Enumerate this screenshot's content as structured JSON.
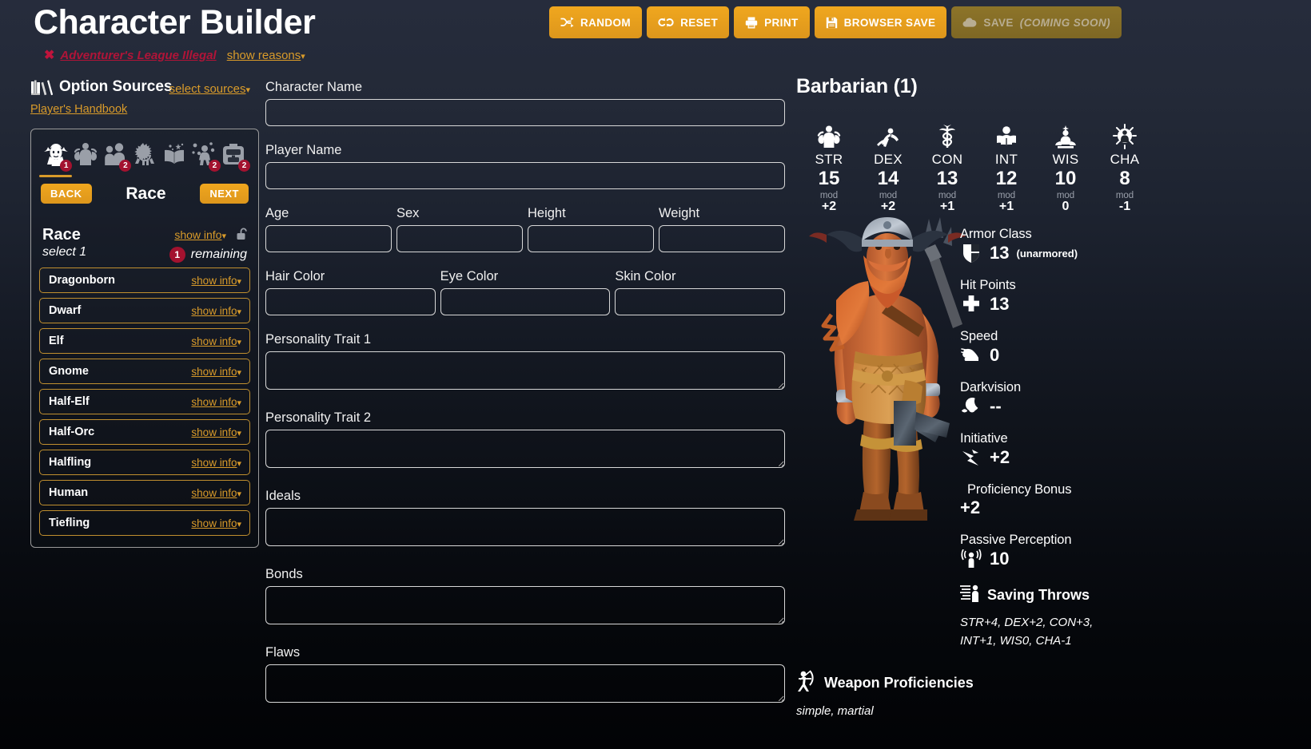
{
  "header": {
    "title": "Character Builder",
    "legality_icon": "x-mark-icon",
    "legality_text": "Adventurer's League Illegal",
    "show_reasons": "show reasons"
  },
  "toolbar": {
    "buttons": [
      {
        "label": "RANDOM",
        "icon": "shuffle-icon",
        "disabled": false
      },
      {
        "label": "RESET",
        "icon": "undo-icon",
        "disabled": false
      },
      {
        "label": "PRINT",
        "icon": "printer-icon",
        "disabled": false
      },
      {
        "label": "BROWSER SAVE",
        "icon": "floppy-disk-icon",
        "disabled": false
      },
      {
        "label": "SAVE",
        "suffix": "(COMING SOON)",
        "icon": "cloud-upload-icon",
        "disabled": true
      }
    ]
  },
  "sidebar": {
    "option_sources_title": "Option Sources",
    "option_sources_icon": "books-icon",
    "select_sources": "select sources",
    "source_name": "Player's Handbook",
    "tabs": [
      {
        "name": "race-tab",
        "icon": "elf-head-icon",
        "badge": "1",
        "active": true
      },
      {
        "name": "abilities-tab",
        "icon": "muscle-icon",
        "badge": "",
        "active": false
      },
      {
        "name": "background-tab",
        "icon": "people-icon",
        "badge": "2",
        "active": false
      },
      {
        "name": "class-tab",
        "icon": "knight-horse-icon",
        "badge": "",
        "active": false
      },
      {
        "name": "spells-tab",
        "icon": "spellbook-icon",
        "badge": "",
        "active": false
      },
      {
        "name": "feats-tab",
        "icon": "juggler-icon",
        "badge": "2",
        "active": false
      },
      {
        "name": "equipment-tab",
        "icon": "backpack-icon",
        "badge": "2",
        "active": false
      }
    ],
    "back_label": "BACK",
    "next_label": "NEXT",
    "step_title": "Race",
    "race_section": {
      "label": "Race",
      "select_hint": "select 1",
      "show_info": "show info",
      "lock_icon": "open-lock-icon",
      "remaining_count": "1",
      "remaining_text": "remaining",
      "items": [
        {
          "name": "Dragonborn",
          "show_info": "show info"
        },
        {
          "name": "Dwarf",
          "show_info": "show info"
        },
        {
          "name": "Elf",
          "show_info": "show info"
        },
        {
          "name": "Gnome",
          "show_info": "show info"
        },
        {
          "name": "Half-Elf",
          "show_info": "show info"
        },
        {
          "name": "Half-Orc",
          "show_info": "show info"
        },
        {
          "name": "Halfling",
          "show_info": "show info"
        },
        {
          "name": "Human",
          "show_info": "show info"
        },
        {
          "name": "Tiefling",
          "show_info": "show info"
        }
      ]
    }
  },
  "form": {
    "character_name": {
      "label": "Character Name",
      "value": ""
    },
    "player_name": {
      "label": "Player Name",
      "value": ""
    },
    "age": {
      "label": "Age",
      "value": ""
    },
    "sex": {
      "label": "Sex",
      "value": ""
    },
    "height": {
      "label": "Height",
      "value": ""
    },
    "weight": {
      "label": "Weight",
      "value": ""
    },
    "hair_color": {
      "label": "Hair Color",
      "value": ""
    },
    "eye_color": {
      "label": "Eye Color",
      "value": ""
    },
    "skin_color": {
      "label": "Skin Color",
      "value": ""
    },
    "trait1": {
      "label": "Personality Trait 1",
      "value": ""
    },
    "trait2": {
      "label": "Personality Trait 2",
      "value": ""
    },
    "ideals": {
      "label": "Ideals",
      "value": ""
    },
    "bonds": {
      "label": "Bonds",
      "value": ""
    },
    "flaws": {
      "label": "Flaws",
      "value": ""
    }
  },
  "character": {
    "class_level": "Barbarian (1)",
    "portrait_icon": "barbarian-portrait",
    "abilities": [
      {
        "name": "STR",
        "score": "15",
        "mod_label": "mod",
        "mod": "+2",
        "icon": "muscle-flex-icon"
      },
      {
        "name": "DEX",
        "score": "14",
        "mod_label": "mod",
        "mod": "+2",
        "icon": "acrobat-icon"
      },
      {
        "name": "CON",
        "score": "13",
        "mod_label": "mod",
        "mod": "+1",
        "icon": "caduceus-icon"
      },
      {
        "name": "INT",
        "score": "12",
        "mod_label": "mod",
        "mod": "+1",
        "icon": "reading-icon"
      },
      {
        "name": "WIS",
        "score": "10",
        "mod_label": "mod",
        "mod": "0",
        "icon": "meditation-icon"
      },
      {
        "name": "CHA",
        "score": "8",
        "mod_label": "mod",
        "mod": "-1",
        "icon": "sun-person-icon"
      }
    ],
    "stats": {
      "armor_class": {
        "label": "Armor Class",
        "value": "13",
        "note": "(unarmored)",
        "icon": "shield-icon"
      },
      "hit_points": {
        "label": "Hit Points",
        "value": "13",
        "icon": "cross-icon"
      },
      "speed": {
        "label": "Speed",
        "value": "0",
        "icon": "boot-icon"
      },
      "darkvision": {
        "label": "Darkvision",
        "value": "--",
        "icon": "night-eyes-icon"
      },
      "initiative": {
        "label": "Initiative",
        "value": "+2",
        "icon": "running-arrow-icon"
      },
      "proficiency_bonus": {
        "label": "Proficiency Bonus",
        "value": "+2"
      },
      "passive_perception": {
        "label": "Passive Perception",
        "value": "10",
        "icon": "perception-icon"
      }
    },
    "saving_throws": {
      "title": "Saving Throws",
      "icon": "saving-throw-icon",
      "text": "STR+4, DEX+2, CON+3, INT+1, WIS0, CHA-1"
    },
    "weapon_proficiencies": {
      "title": "Weapon Proficiencies",
      "icon": "archer-icon",
      "text": "simple, martial"
    }
  },
  "colors": {
    "accent": "#d99b2a",
    "button": "#f0a71e",
    "danger": "#a3122f",
    "illegal": "#b01438",
    "background_top": "#262c3c",
    "background_bottom": "#020305"
  }
}
